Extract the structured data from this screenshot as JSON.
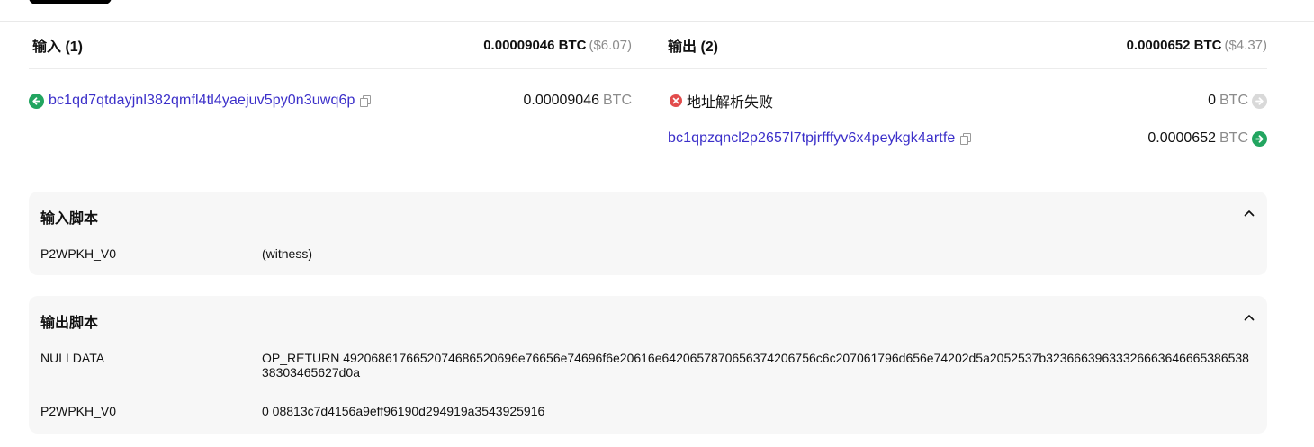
{
  "inputs": {
    "title": "输入 (1)",
    "total_btc": "0.00009046 BTC",
    "total_usd": "($6.07)",
    "items": [
      {
        "address": "bc1qd7qtdayjnl382qmfl4tl4yaejuv5py0n3uwq6p",
        "amount": "0.00009046",
        "unit": "BTC"
      }
    ]
  },
  "outputs": {
    "title": "输出 (2)",
    "total_btc": "0.0000652 BTC",
    "total_usd": "($4.37)",
    "items": [
      {
        "label": "地址解析失败",
        "amount": "0",
        "unit": "BTC"
      },
      {
        "address": "bc1qpzqncl2p2657l7tpjrfffyv6x4peykgk4artfe",
        "amount": "0.0000652",
        "unit": "BTC"
      }
    ]
  },
  "input_script": {
    "title": "输入脚本",
    "rows": [
      {
        "type": "P2WPKH_V0",
        "value": "(witness)"
      }
    ]
  },
  "output_script": {
    "title": "输出脚本",
    "rows": [
      {
        "type": "NULLDATA",
        "value": "OP_RETURN 4920686176652074686520696e76656e74696f6e20616e6420657870656374206756c6c207061796d656e74202d5a2052537b3236663963332666364666538653838303465627d0a"
      },
      {
        "type": "P2WPKH_V0",
        "value": "0 08813c7d4156a9eff96190d294919a3543925916"
      }
    ]
  },
  "icons": {
    "input_arrow": "arrow-left-circle-icon",
    "output_arrow": "arrow-right-circle-icon",
    "error": "error-x-icon",
    "copy": "copy-icon",
    "collapse": "chevron-up-icon"
  },
  "colors": {
    "address": "#3b2fc9",
    "success": "#22a560",
    "error": "#e24c4c",
    "muted": "#8c8c8c",
    "panel_bg": "#f7f7f7"
  }
}
